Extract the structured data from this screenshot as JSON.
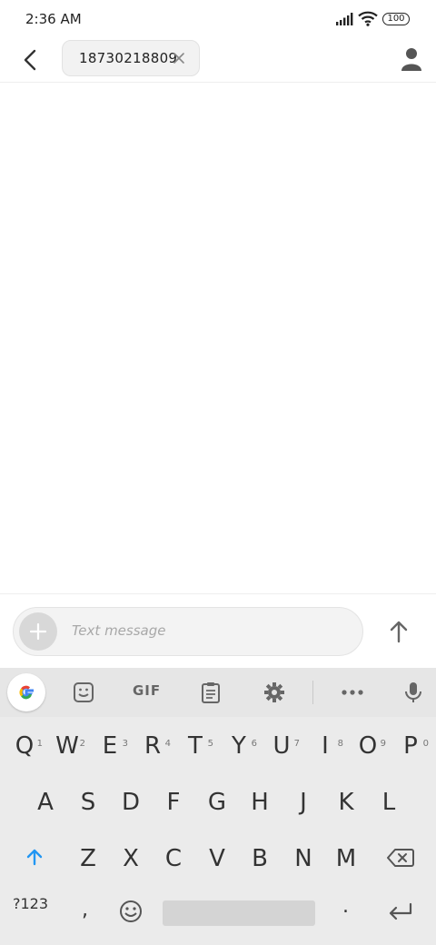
{
  "status": {
    "time": "2:36 AM",
    "battery": "100"
  },
  "header": {
    "recipient": "18730218809"
  },
  "composer": {
    "placeholder": "Text message"
  },
  "keyboard": {
    "toolbar": {
      "gif_label": "GIF"
    },
    "row1": [
      {
        "key": "Q",
        "hint": "1"
      },
      {
        "key": "W",
        "hint": "2"
      },
      {
        "key": "E",
        "hint": "3"
      },
      {
        "key": "R",
        "hint": "4"
      },
      {
        "key": "T",
        "hint": "5"
      },
      {
        "key": "Y",
        "hint": "6"
      },
      {
        "key": "U",
        "hint": "7"
      },
      {
        "key": "I",
        "hint": "8"
      },
      {
        "key": "O",
        "hint": "9"
      },
      {
        "key": "P",
        "hint": "0"
      }
    ],
    "row2": [
      "A",
      "S",
      "D",
      "F",
      "G",
      "H",
      "J",
      "K",
      "L"
    ],
    "row3": [
      "Z",
      "X",
      "C",
      "V",
      "B",
      "N",
      "M"
    ],
    "bottom": {
      "symbols_label": "?123",
      "comma": ",",
      "period": "."
    }
  },
  "colors": {
    "accent": "#1a73e8",
    "shift_active": "#2196f3"
  }
}
